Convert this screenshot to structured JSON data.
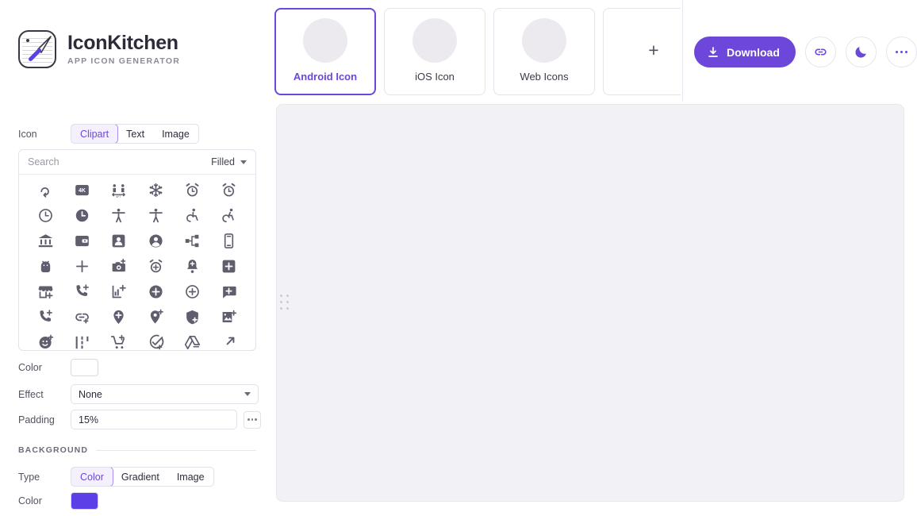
{
  "brand": {
    "title": "IconKitchen",
    "subtitle": "APP ICON GENERATOR",
    "logo_icon": "knife-palette-icon"
  },
  "tabs": {
    "items": [
      {
        "label": "Android Icon",
        "active": true
      },
      {
        "label": "iOS Icon",
        "active": false
      },
      {
        "label": "Web Icons",
        "active": false
      }
    ],
    "add_label": "+"
  },
  "actions": {
    "download_label": "Download",
    "download_icon": "download-icon",
    "link_icon": "link-icon",
    "theme_icon": "moon-icon",
    "more_icon": "more-horizontal-icon"
  },
  "icon_section": {
    "label": "Icon",
    "source_types": [
      "Clipart",
      "Text",
      "Image"
    ],
    "selected_source": "Clipart",
    "search_placeholder": "Search",
    "search_value": "",
    "style_filter": "Filled",
    "color_label": "Color",
    "color_value": "#ffffff",
    "effect_label": "Effect",
    "effect_value": "None",
    "padding_label": "Padding",
    "padding_value": "15%",
    "padding_more_icon": "more-horizontal-icon",
    "clipart_icons": [
      "rotate-loop-icon",
      "4k-icon",
      "social-distance-icon",
      "ac-unit-icon",
      "access-alarm-icon",
      "access-alarms-icon",
      "access-time-icon",
      "access-time-filled-icon",
      "accessibility-icon",
      "accessibility-new-icon",
      "accessible-icon",
      "accessible-forward-icon",
      "account-balance-icon",
      "account-balance-wallet-icon",
      "account-box-icon",
      "account-circle-icon",
      "account-tree-icon",
      "ad-units-icon",
      "adb-icon",
      "add-icon",
      "add-a-photo-icon",
      "add-alarm-icon",
      "add-alert-icon",
      "add-box-icon",
      "add-business-icon",
      "add-call-icon",
      "add-chart-icon",
      "add-circle-icon",
      "add-circle-outline-icon",
      "add-comment-icon",
      "add-ic-call-icon",
      "add-link-icon",
      "add-location-icon",
      "add-location-alt-icon",
      "add-moderator-icon",
      "add-photo-alternate-icon",
      "add-reaction-icon",
      "add-road-icon",
      "add-shopping-cart-icon",
      "add-task-icon",
      "add-to-drive-icon",
      "add-to-home-screen-icon"
    ]
  },
  "background_section": {
    "heading": "BACKGROUND",
    "type_label": "Type",
    "types": [
      "Color",
      "Gradient",
      "Image"
    ],
    "selected_type": "Color",
    "color_label": "Color",
    "color_value": "#5d3fe8"
  },
  "canvas": {
    "drag_handle_icon": "drag-dots-icon"
  },
  "colors": {
    "accent": "#6c47d9",
    "accent_soft": "#f4f0fe",
    "icon_gray": "#5f5d6e",
    "canvas_bg": "#f2f1f6",
    "border": "#e4e2ea"
  }
}
